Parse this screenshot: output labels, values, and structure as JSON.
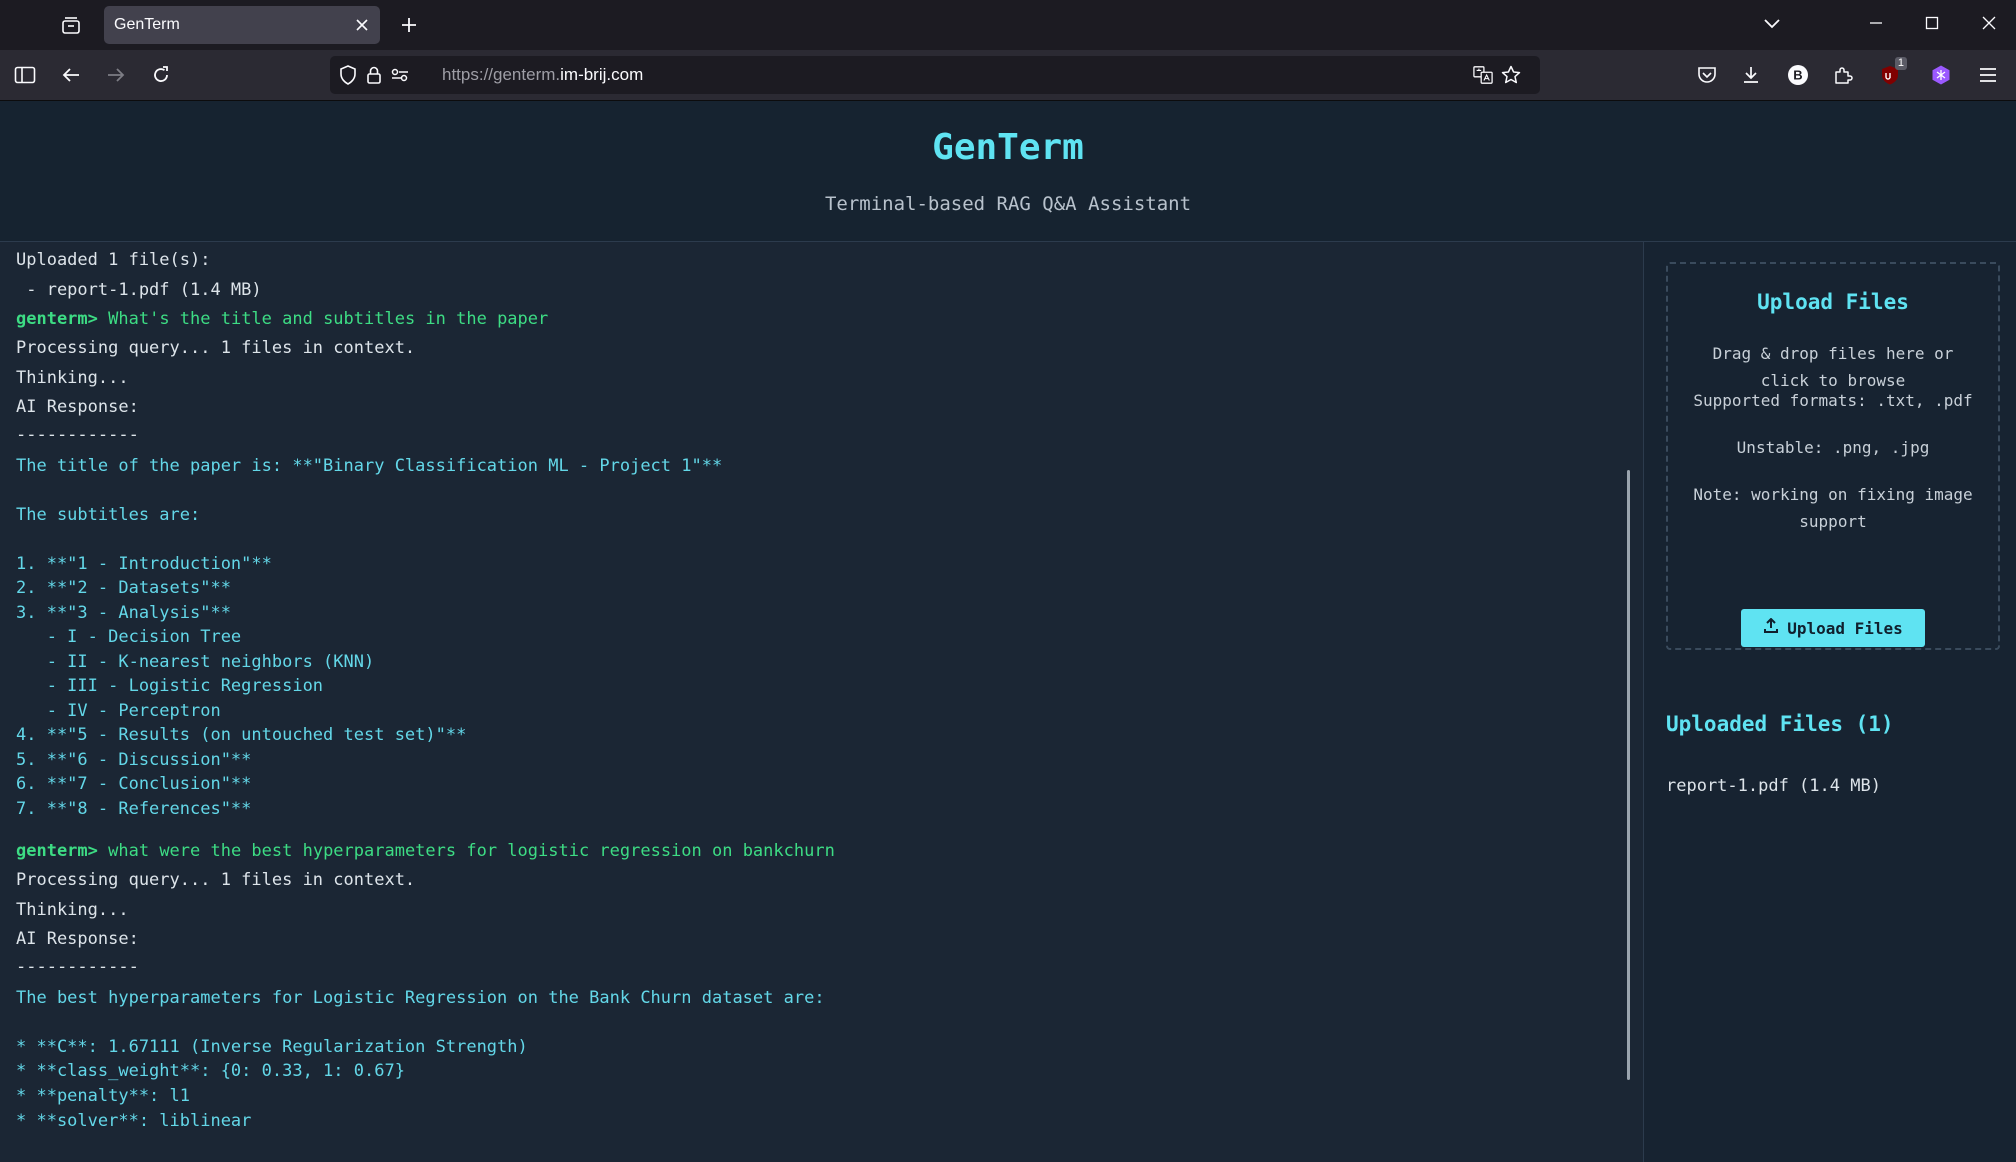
{
  "browser": {
    "tab_title": "GenTerm",
    "url_scheme": "https://genterm.",
    "url_host": "im-brij.com",
    "extension_badge": "1",
    "bitwarden_letter": "B"
  },
  "header": {
    "title": "GenTerm",
    "subtitle": "Terminal-based RAG Q&A Assistant"
  },
  "terminal": {
    "prompt": "genterm>",
    "lines": [
      "Uploaded 1 file(s):",
      " - report-1.pdf (1.4 MB)",
      "What's the title and subtitles in the paper",
      "Processing query... 1 files in context.",
      "Thinking...",
      "AI Response:",
      "------------",
      "The title of the paper is: **\"Binary Classification ML - Project 1\"**",
      "The subtitles are:",
      "1. **\"1 - Introduction\"**",
      "2. **\"2 - Datasets\"**",
      "3. **\"3 - Analysis\"**",
      "   - I - Decision Tree",
      "   - II - K-nearest neighbors (KNN)",
      "   - III - Logistic Regression",
      "   - IV - Perceptron",
      "4. **\"5 - Results (on untouched test set)\"**",
      "5. **\"6 - Discussion\"**",
      "6. **\"7 - Conclusion\"**",
      "7. **\"8 - References\"**",
      "what were the best hyperparameters for logistic regression on bankchurn",
      "Processing query... 1 files in context.",
      "Thinking...",
      "AI Response:",
      "------------",
      "The best hyperparameters for Logistic Regression on the Bank Churn dataset are:",
      "* **C**: 1.67111 (Inverse Regularization Strength)",
      "* **class_weight**: {0: 0.33, 1: 0.67}",
      "* **penalty**: l1",
      "* **solver**: liblinear"
    ]
  },
  "sidebar": {
    "upload_title": "Upload Files",
    "drag_text": "Drag & drop files here or click to browse",
    "formats_text": "Supported formats: .txt, .pdf",
    "unstable_text": "Unstable: .png, .jpg",
    "note_text": "Note: working on fixing image support",
    "upload_button": "Upload Files",
    "uploaded_title": "Uploaded Files (1)",
    "uploaded_file": "report-1.pdf (1.4 MB)"
  }
}
